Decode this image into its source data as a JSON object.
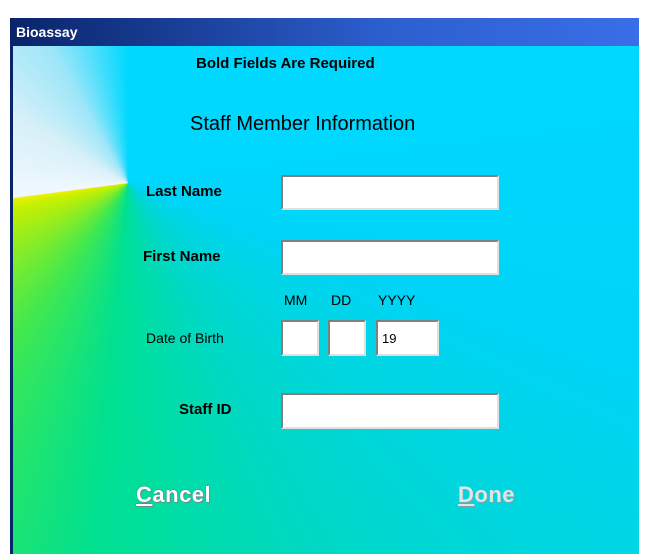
{
  "window": {
    "title": "Bioassay"
  },
  "header": {
    "required_notice": "Bold Fields Are Required",
    "section_title": "Staff Member Information"
  },
  "form": {
    "last_name": {
      "label": "Last Name",
      "value": ""
    },
    "first_name": {
      "label": "First Name",
      "value": ""
    },
    "dob": {
      "label": "Date of Birth",
      "mm_label": "MM",
      "dd_label": "DD",
      "yyyy_label": "YYYY",
      "mm_value": "",
      "dd_value": "",
      "yyyy_value": "19"
    },
    "staff_id": {
      "label": "Staff ID",
      "value": ""
    }
  },
  "buttons": {
    "cancel": {
      "label_first": "C",
      "label_rest": "ancel"
    },
    "done": {
      "label_first": "D",
      "label_rest": "one"
    }
  }
}
